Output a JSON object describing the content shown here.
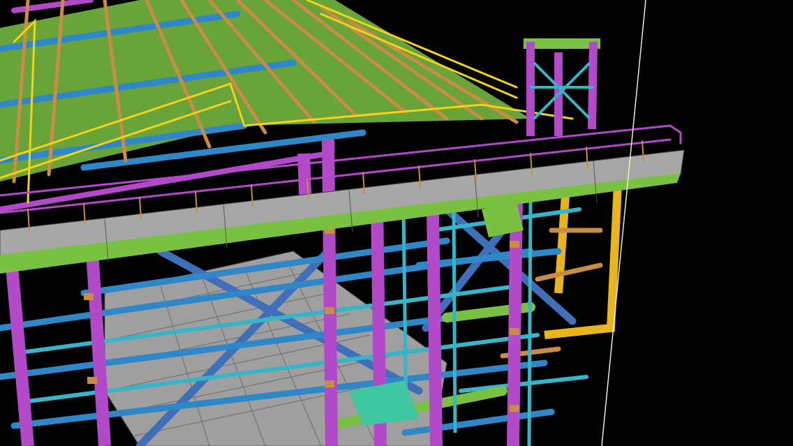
{
  "scene": {
    "kind": "3d-structural-steel-model",
    "background": "#000000",
    "palette": {
      "beam_green": "#7ac143",
      "beam_blue": "#2e88c8",
      "beam_cyan": "#36b5c9",
      "column_magenta": "#b149c9",
      "purlin_orange": "#c98c45",
      "handrail_yellow": "#f2d318",
      "frame_gold": "#e8b61c",
      "grating_gray": "#a7a7a7",
      "bracing_steel_blue": "#3e6fb8",
      "equipment_teal": "#3fc8a0",
      "construction_line": "#e9f0c8"
    },
    "components": [
      "roof-purlins",
      "roof-rafters",
      "walkway-platform",
      "handrails",
      "columns",
      "floor-beams",
      "cross-bracing",
      "floor-grating",
      "stair-tower",
      "side-frame",
      "construction-line"
    ]
  }
}
